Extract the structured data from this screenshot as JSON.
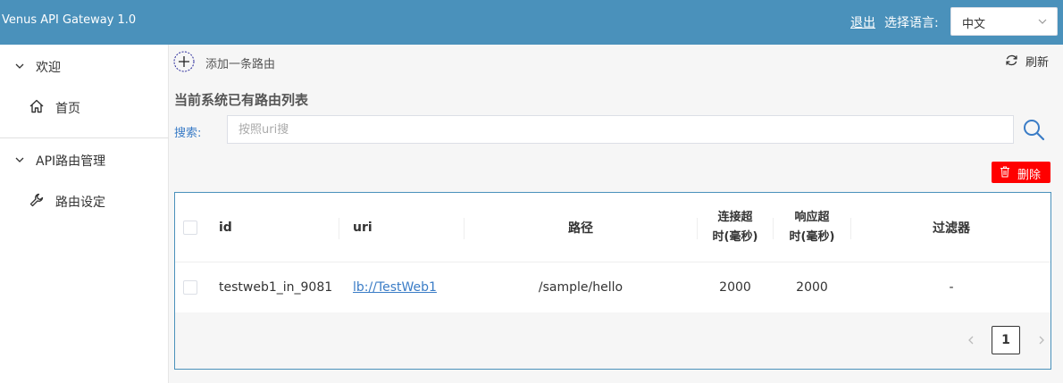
{
  "header": {
    "app_title": "Venus API Gateway 1.0",
    "logout_label": "退出",
    "language_label": "选择语言:",
    "language_selected": "中文"
  },
  "sidebar": {
    "groups": [
      {
        "label": "欢迎",
        "items": [
          {
            "label": "首页",
            "icon": "home-icon"
          }
        ]
      },
      {
        "label": "API路由管理",
        "items": [
          {
            "label": "路由设定",
            "icon": "wrench-icon"
          }
        ]
      }
    ]
  },
  "toolbar": {
    "add_route_label": "添加一条路由",
    "refresh_label": "刷新"
  },
  "main": {
    "list_title": "当前系统已有路由列表",
    "search_label": "搜索:",
    "search_placeholder": "按照uri搜",
    "delete_label": "删除"
  },
  "table": {
    "headers": {
      "id": "id",
      "uri": "uri",
      "path": "路径",
      "connect_timeout_line1": "连接超",
      "connect_timeout_line2": "时(毫秒)",
      "response_timeout_line1": "响应超",
      "response_timeout_line2": "时(毫秒)",
      "filters": "过滤器"
    },
    "rows": [
      {
        "id": "testweb1_in_9081",
        "uri": "lb://TestWeb1",
        "path": "/sample/hello",
        "connect_timeout": "2000",
        "response_timeout": "2000",
        "filters": "-"
      }
    ]
  },
  "pagination": {
    "current_page": "1"
  },
  "colors": {
    "header_bg": "#4a91bb",
    "link": "#3a7cc6",
    "danger": "#ff0000"
  }
}
